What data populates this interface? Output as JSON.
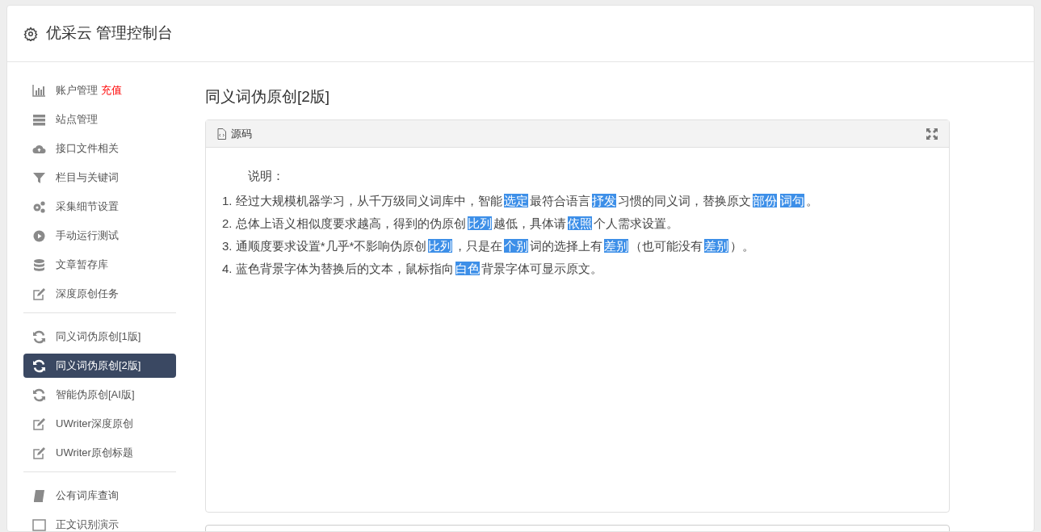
{
  "header": {
    "title": "优采云 管理控制台"
  },
  "sidebar": {
    "groups": [
      {
        "items": [
          {
            "label": "账户管理",
            "badge": "充值",
            "selected": false
          },
          {
            "label": "站点管理",
            "selected": false
          },
          {
            "label": "接口文件相关",
            "selected": false
          },
          {
            "label": "栏目与关键词",
            "selected": false
          },
          {
            "label": "采集细节设置",
            "selected": false
          },
          {
            "label": "手动运行测试",
            "selected": false
          },
          {
            "label": "文章暂存库",
            "selected": false
          },
          {
            "label": "深度原创任务",
            "selected": false
          }
        ]
      },
      {
        "items": [
          {
            "label": "同义词伪原创[1版]",
            "selected": false
          },
          {
            "label": "同义词伪原创[2版]",
            "selected": true
          },
          {
            "label": "智能伪原创[AI版]",
            "selected": false
          },
          {
            "label": "UWriter深度原创",
            "selected": false
          },
          {
            "label": "UWriter原创标题",
            "selected": false
          }
        ]
      },
      {
        "items": [
          {
            "label": "公有词库查询",
            "selected": false
          },
          {
            "label": "正文识别演示",
            "selected": false
          }
        ]
      }
    ]
  },
  "page_title": "同义词伪原创[2版]",
  "panel": {
    "title": "源码",
    "intro": "说明：",
    "lines": [
      [
        {
          "text": "1. 经过大规模机器学习，从千万级同义词库中，智能",
          "replaced": false
        },
        {
          "text": "选定",
          "replaced": true
        },
        {
          "text": "最符合语言",
          "replaced": false
        },
        {
          "text": "抒发",
          "replaced": true
        },
        {
          "text": "习惯的同义词，替换原文",
          "replaced": false
        },
        {
          "text": "部份",
          "replaced": true
        },
        {
          "text": "词句",
          "replaced": true
        },
        {
          "text": "。",
          "replaced": false
        }
      ],
      [
        {
          "text": "2. 总体上语义相似度要求越高，得到的伪原创",
          "replaced": false
        },
        {
          "text": "比列",
          "replaced": true
        },
        {
          "text": "越低，具体请",
          "replaced": false
        },
        {
          "text": "依照",
          "replaced": true
        },
        {
          "text": "个人需求设置。",
          "replaced": false
        }
      ],
      [
        {
          "text": "3. 通顺度要求设置*几乎*不影响伪原创",
          "replaced": false
        },
        {
          "text": "比列",
          "replaced": true
        },
        {
          "text": "，只是在",
          "replaced": false
        },
        {
          "text": "个别",
          "replaced": true
        },
        {
          "text": "词的选择上有",
          "replaced": false
        },
        {
          "text": "差别",
          "replaced": true
        },
        {
          "text": "（也可能没有",
          "replaced": false
        },
        {
          "text": "差别",
          "replaced": true
        },
        {
          "text": "）。",
          "replaced": false
        }
      ],
      [
        {
          "text": "4. 蓝色背景字体为替换后的文本，鼠标指向",
          "replaced": false
        },
        {
          "text": "白色",
          "replaced": true
        },
        {
          "text": "背景字体可显示原文。",
          "replaced": false
        }
      ]
    ]
  }
}
